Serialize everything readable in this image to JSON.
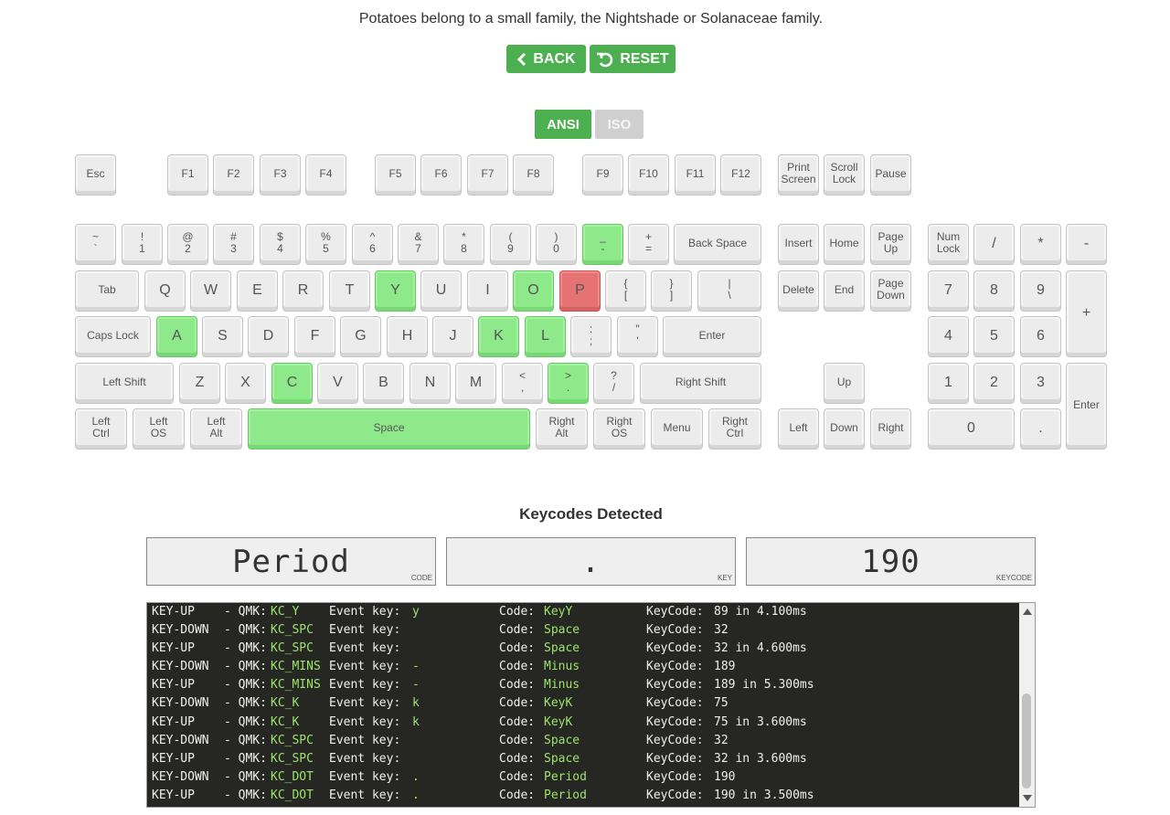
{
  "fact": "Potatoes belong to a small family, the Nightshade or Solanaceae family.",
  "buttons": {
    "back": "BACK",
    "reset": "RESET"
  },
  "layouts": {
    "ansi": "ANSI",
    "iso": "ISO",
    "active": "ANSI"
  },
  "colors": {
    "accent": "#4caf50",
    "pressed": "#8ee98a",
    "error": "#e57373",
    "inactive": "#cfcfcf",
    "log_bg": "#262622",
    "log_green": "#9de56f"
  },
  "keys": [
    {
      "id": "esc",
      "label": "Esc",
      "state": ""
    },
    {
      "id": "f1",
      "label": "F1",
      "state": ""
    },
    {
      "id": "f2",
      "label": "F2",
      "state": ""
    },
    {
      "id": "f3",
      "label": "F3",
      "state": ""
    },
    {
      "id": "f4",
      "label": "F4",
      "state": ""
    },
    {
      "id": "f5",
      "label": "F5",
      "state": ""
    },
    {
      "id": "f6",
      "label": "F6",
      "state": ""
    },
    {
      "id": "f7",
      "label": "F7",
      "state": ""
    },
    {
      "id": "f8",
      "label": "F8",
      "state": ""
    },
    {
      "id": "f9",
      "label": "F9",
      "state": ""
    },
    {
      "id": "f10",
      "label": "F10",
      "state": ""
    },
    {
      "id": "f11",
      "label": "F11",
      "state": ""
    },
    {
      "id": "f12",
      "label": "F12",
      "state": ""
    },
    {
      "id": "printscreen",
      "label": "Print\nScreen",
      "state": ""
    },
    {
      "id": "scrolllock",
      "label": "Scroll\nLock",
      "state": ""
    },
    {
      "id": "pause",
      "label": "Pause",
      "state": ""
    },
    {
      "id": "grave",
      "label": "~\n`",
      "state": ""
    },
    {
      "id": "1",
      "label": "!\n1",
      "state": ""
    },
    {
      "id": "2",
      "label": "@\n2",
      "state": ""
    },
    {
      "id": "3",
      "label": "#\n3",
      "state": ""
    },
    {
      "id": "4",
      "label": "$\n4",
      "state": ""
    },
    {
      "id": "5",
      "label": "%\n5",
      "state": ""
    },
    {
      "id": "6",
      "label": "^\n6",
      "state": ""
    },
    {
      "id": "7",
      "label": "&\n7",
      "state": ""
    },
    {
      "id": "8",
      "label": "*\n8",
      "state": ""
    },
    {
      "id": "9",
      "label": "(\n9",
      "state": ""
    },
    {
      "id": "0",
      "label": ")\n0",
      "state": ""
    },
    {
      "id": "minus",
      "label": "_\n-",
      "state": "on"
    },
    {
      "id": "equal",
      "label": "+\n=",
      "state": ""
    },
    {
      "id": "backspace",
      "label": "Back Space",
      "state": ""
    },
    {
      "id": "insert",
      "label": "Insert",
      "state": ""
    },
    {
      "id": "home",
      "label": "Home",
      "state": ""
    },
    {
      "id": "pageup",
      "label": "Page\nUp",
      "state": ""
    },
    {
      "id": "numlock",
      "label": "Num\nLock",
      "state": ""
    },
    {
      "id": "npdiv",
      "label": "/",
      "state": ""
    },
    {
      "id": "npmul",
      "label": "*",
      "state": ""
    },
    {
      "id": "npsub",
      "label": "-",
      "state": ""
    },
    {
      "id": "tab",
      "label": "Tab",
      "state": ""
    },
    {
      "id": "q",
      "label": "Q",
      "state": ""
    },
    {
      "id": "w",
      "label": "W",
      "state": ""
    },
    {
      "id": "e",
      "label": "E",
      "state": ""
    },
    {
      "id": "r",
      "label": "R",
      "state": ""
    },
    {
      "id": "t",
      "label": "T",
      "state": ""
    },
    {
      "id": "y",
      "label": "Y",
      "state": "on"
    },
    {
      "id": "u",
      "label": "U",
      "state": ""
    },
    {
      "id": "i",
      "label": "I",
      "state": ""
    },
    {
      "id": "o",
      "label": "O",
      "state": "on"
    },
    {
      "id": "p",
      "label": "P",
      "state": "bad"
    },
    {
      "id": "lbracket",
      "label": "{\n[",
      "state": ""
    },
    {
      "id": "rbracket",
      "label": "}\n]",
      "state": ""
    },
    {
      "id": "backslash",
      "label": "|\n\\",
      "state": ""
    },
    {
      "id": "delete",
      "label": "Delete",
      "state": ""
    },
    {
      "id": "end",
      "label": "End",
      "state": ""
    },
    {
      "id": "pagedown",
      "label": "Page\nDown",
      "state": ""
    },
    {
      "id": "np7",
      "label": "7",
      "state": ""
    },
    {
      "id": "np8",
      "label": "8",
      "state": ""
    },
    {
      "id": "np9",
      "label": "9",
      "state": ""
    },
    {
      "id": "npadd",
      "label": "+",
      "state": ""
    },
    {
      "id": "capslock",
      "label": "Caps Lock",
      "state": ""
    },
    {
      "id": "a",
      "label": "A",
      "state": "on"
    },
    {
      "id": "s",
      "label": "S",
      "state": ""
    },
    {
      "id": "d",
      "label": "D",
      "state": ""
    },
    {
      "id": "f",
      "label": "F",
      "state": ""
    },
    {
      "id": "g",
      "label": "G",
      "state": ""
    },
    {
      "id": "h",
      "label": "H",
      "state": ""
    },
    {
      "id": "j",
      "label": "J",
      "state": ""
    },
    {
      "id": "k",
      "label": "K",
      "state": "on"
    },
    {
      "id": "l",
      "label": "L",
      "state": "on"
    },
    {
      "id": "semicolon",
      "label": ":\n;",
      "state": ""
    },
    {
      "id": "quote",
      "label": "\"\n'",
      "state": ""
    },
    {
      "id": "enter",
      "label": "Enter",
      "state": ""
    },
    {
      "id": "np4",
      "label": "4",
      "state": ""
    },
    {
      "id": "np5",
      "label": "5",
      "state": ""
    },
    {
      "id": "np6",
      "label": "6",
      "state": ""
    },
    {
      "id": "lshift",
      "label": "Left Shift",
      "state": ""
    },
    {
      "id": "z",
      "label": "Z",
      "state": ""
    },
    {
      "id": "x",
      "label": "X",
      "state": ""
    },
    {
      "id": "c",
      "label": "C",
      "state": "on"
    },
    {
      "id": "v",
      "label": "V",
      "state": ""
    },
    {
      "id": "b",
      "label": "B",
      "state": ""
    },
    {
      "id": "n",
      "label": "N",
      "state": ""
    },
    {
      "id": "m",
      "label": "M",
      "state": ""
    },
    {
      "id": "comma",
      "label": "<\n,",
      "state": ""
    },
    {
      "id": "period",
      "label": ">\n.",
      "state": "on"
    },
    {
      "id": "slash",
      "label": "?\n/",
      "state": ""
    },
    {
      "id": "rshift",
      "label": "Right Shift",
      "state": ""
    },
    {
      "id": "up",
      "label": "Up",
      "state": ""
    },
    {
      "id": "np1",
      "label": "1",
      "state": ""
    },
    {
      "id": "np2",
      "label": "2",
      "state": ""
    },
    {
      "id": "np3",
      "label": "3",
      "state": ""
    },
    {
      "id": "npenter",
      "label": "Enter",
      "state": ""
    },
    {
      "id": "lctrl",
      "label": "Left\nCtrl",
      "state": ""
    },
    {
      "id": "los",
      "label": "Left\nOS",
      "state": ""
    },
    {
      "id": "lalt",
      "label": "Left\nAlt",
      "state": ""
    },
    {
      "id": "space",
      "label": "Space",
      "state": "on"
    },
    {
      "id": "ralt",
      "label": "Right\nAlt",
      "state": ""
    },
    {
      "id": "ros",
      "label": "Right\nOS",
      "state": ""
    },
    {
      "id": "menu",
      "label": "Menu",
      "state": ""
    },
    {
      "id": "rctrl",
      "label": "Right\nCtrl",
      "state": ""
    },
    {
      "id": "left",
      "label": "Left",
      "state": ""
    },
    {
      "id": "down",
      "label": "Down",
      "state": ""
    },
    {
      "id": "right",
      "label": "Right",
      "state": ""
    },
    {
      "id": "np0",
      "label": "0",
      "state": ""
    },
    {
      "id": "npdot",
      "label": ".",
      "state": ""
    }
  ],
  "detected": {
    "heading": "Keycodes Detected",
    "code": "Period",
    "code_caption": "CODE",
    "key": ".",
    "key_caption": "KEY",
    "keycode": "190",
    "keycode_caption": "KEYCODE"
  },
  "log": [
    {
      "event": "KEY-UP  ",
      "qmk": "KC_Y",
      "key": "y",
      "code": "KeyY",
      "keycode": "89 in 4.100ms"
    },
    {
      "event": "KEY-DOWN",
      "qmk": "KC_SPC",
      "key": "",
      "code": "Space",
      "keycode": "32"
    },
    {
      "event": "KEY-UP  ",
      "qmk": "KC_SPC",
      "key": "",
      "code": "Space",
      "keycode": "32 in 4.600ms"
    },
    {
      "event": "KEY-DOWN",
      "qmk": "KC_MINS",
      "key": "-",
      "code": "Minus",
      "keycode": "189"
    },
    {
      "event": "KEY-UP  ",
      "qmk": "KC_MINS",
      "key": "-",
      "code": "Minus",
      "keycode": "189 in 5.300ms"
    },
    {
      "event": "KEY-DOWN",
      "qmk": "KC_K",
      "key": "k",
      "code": "KeyK",
      "keycode": "75"
    },
    {
      "event": "KEY-UP  ",
      "qmk": "KC_K",
      "key": "k",
      "code": "KeyK",
      "keycode": "75 in 3.600ms"
    },
    {
      "event": "KEY-DOWN",
      "qmk": "KC_SPC",
      "key": "",
      "code": "Space",
      "keycode": "32"
    },
    {
      "event": "KEY-UP  ",
      "qmk": "KC_SPC",
      "key": "",
      "code": "Space",
      "keycode": "32 in 3.600ms"
    },
    {
      "event": "KEY-DOWN",
      "qmk": "KC_DOT",
      "key": ".",
      "code": "Period",
      "keycode": "190"
    },
    {
      "event": "KEY-UP  ",
      "qmk": "KC_DOT",
      "key": ".",
      "code": "Period",
      "keycode": "190 in 3.500ms"
    }
  ],
  "log_labels": {
    "qmk": "- QMK:",
    "key": "Event key:",
    "code": "Code:",
    "keycode": "KeyCode:"
  }
}
